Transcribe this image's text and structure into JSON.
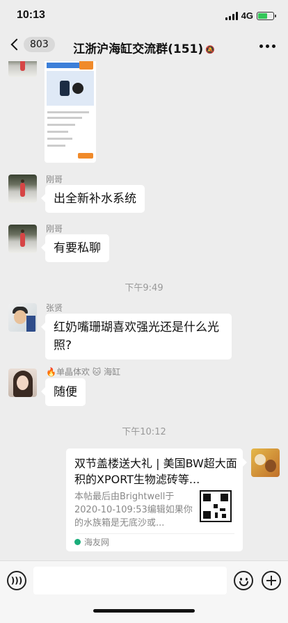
{
  "status_bar": {
    "time": "10:13",
    "network": "4G"
  },
  "nav": {
    "unread_count": "803",
    "title": "江浙沪海缸交流群(151)"
  },
  "messages": {
    "m1": {
      "sender": "刚哥",
      "text": "出全新补水系统"
    },
    "m2": {
      "sender": "刚哥",
      "text": "有要私聊"
    },
    "t1": "下午9:49",
    "m3": {
      "sender": "张贤",
      "text": "红奶嘴珊瑚喜欢强光还是什么光照?"
    },
    "m4": {
      "sender_prefix": "🔥",
      "sender_name": "单晶体欢",
      "sender_mid": "🐱",
      "sender_suffix": "海缸",
      "text": "随便"
    },
    "t2": "下午10:12",
    "link": {
      "title": "双节盖楼送大礼 | 美国BW超大面积的XPORT生物滤砖等...",
      "desc": "本帖最后由Brightwell于2020-10-109:53编辑如果你的水族箱是无底沙或...",
      "source": "海友网"
    }
  },
  "colors": {
    "background": "#ededed",
    "bubble": "#ffffff",
    "battery": "#34c759"
  },
  "icons": [
    "back-chevron-icon",
    "mute-icon",
    "more-icon",
    "voice-icon",
    "emoji-icon",
    "plus-icon"
  ]
}
